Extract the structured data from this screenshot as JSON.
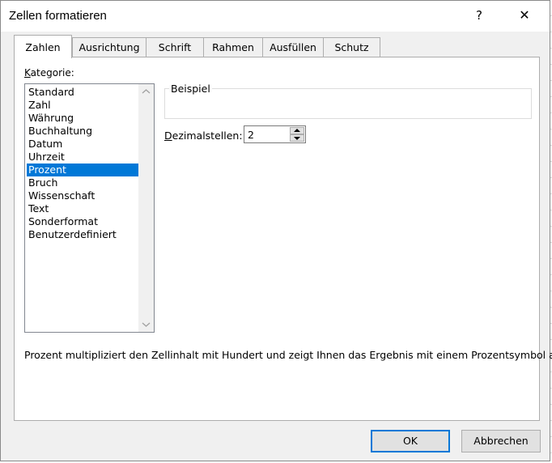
{
  "window": {
    "title": "Zellen formatieren",
    "help": "?",
    "close": "✕"
  },
  "tabs": [
    {
      "label": "Zahlen",
      "active": true
    },
    {
      "label": "Ausrichtung"
    },
    {
      "label": "Schrift"
    },
    {
      "label": "Rahmen"
    },
    {
      "label": "Ausfüllen"
    },
    {
      "label": "Schutz"
    }
  ],
  "kategorie": {
    "label_ul": "K",
    "label_rest": "ategorie:",
    "items": [
      "Standard",
      "Zahl",
      "Währung",
      "Buchhaltung",
      "Datum",
      "Uhrzeit",
      "Prozent",
      "Bruch",
      "Wissenschaft",
      "Text",
      "Sonderformat",
      "Benutzerdefiniert"
    ],
    "selected": "Prozent"
  },
  "beispiel": {
    "label": "Beispiel",
    "value": ""
  },
  "dezimalstellen": {
    "label_ul": "D",
    "label_rest": "ezimalstellen:",
    "value": "2"
  },
  "description": "Prozent multipliziert den Zellinhalt mit Hundert und zeigt Ihnen das Ergebnis mit einem Prozentsymbol an.",
  "buttons": {
    "ok": "OK",
    "cancel": "Abbrechen"
  },
  "colors": {
    "accent": "#0078d7"
  }
}
